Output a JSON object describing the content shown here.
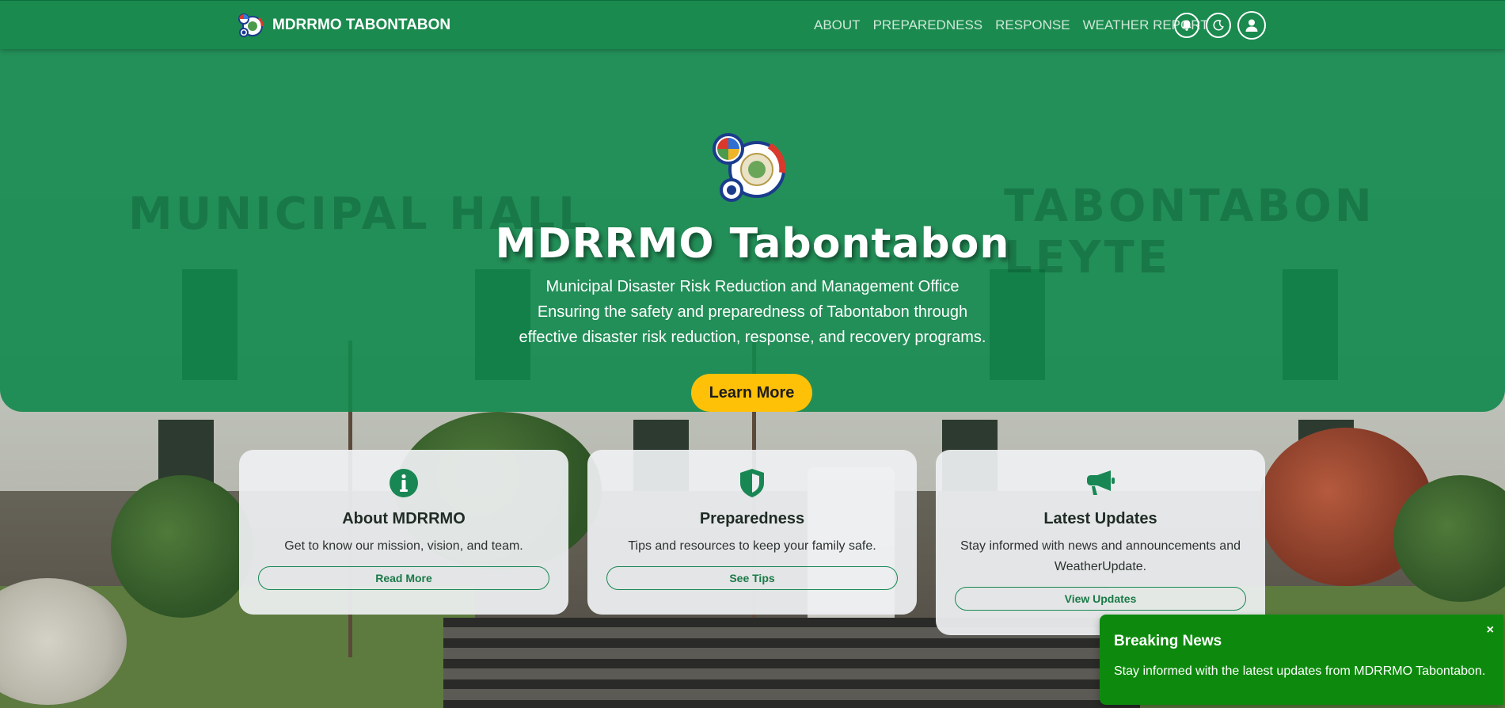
{
  "navbar": {
    "brand": "MDRRMO TABONTABON",
    "links": [
      "ABOUT",
      "PREPAREDNESS",
      "RESPONSE",
      "WEATHER REPORT"
    ],
    "icons": [
      "bell-icon",
      "moon-icon",
      "user-icon"
    ]
  },
  "hero": {
    "title": "MDRRMO Tabontabon",
    "subtitle_lines": [
      "Municipal Disaster Risk Reduction and Management Office",
      "Ensuring the safety and preparedness of Tabontabon through",
      "effective disaster risk reduction, response, and recovery programs."
    ],
    "button": "Learn More"
  },
  "cards": [
    {
      "icon": "info-icon",
      "title": "About MDRRMO",
      "text": "Get to know our mission, vision, and team.",
      "button": "Read More"
    },
    {
      "icon": "shield-icon",
      "title": "Preparedness",
      "text": "Tips and resources to keep your family safe.",
      "button": "See Tips"
    },
    {
      "icon": "megaphone-icon",
      "title": "Latest Updates",
      "text": "Stay informed with news and announcements and WeatherUpdate.",
      "button": "View Updates"
    }
  ],
  "toast": {
    "title": "Breaking News",
    "text": "Stay informed with the latest updates from MDRRMO Tabontabon.",
    "close": "×"
  },
  "colors": {
    "primary_green": "#198754",
    "accent_yellow": "#ffc107",
    "toast_green": "#0d8a0d"
  }
}
